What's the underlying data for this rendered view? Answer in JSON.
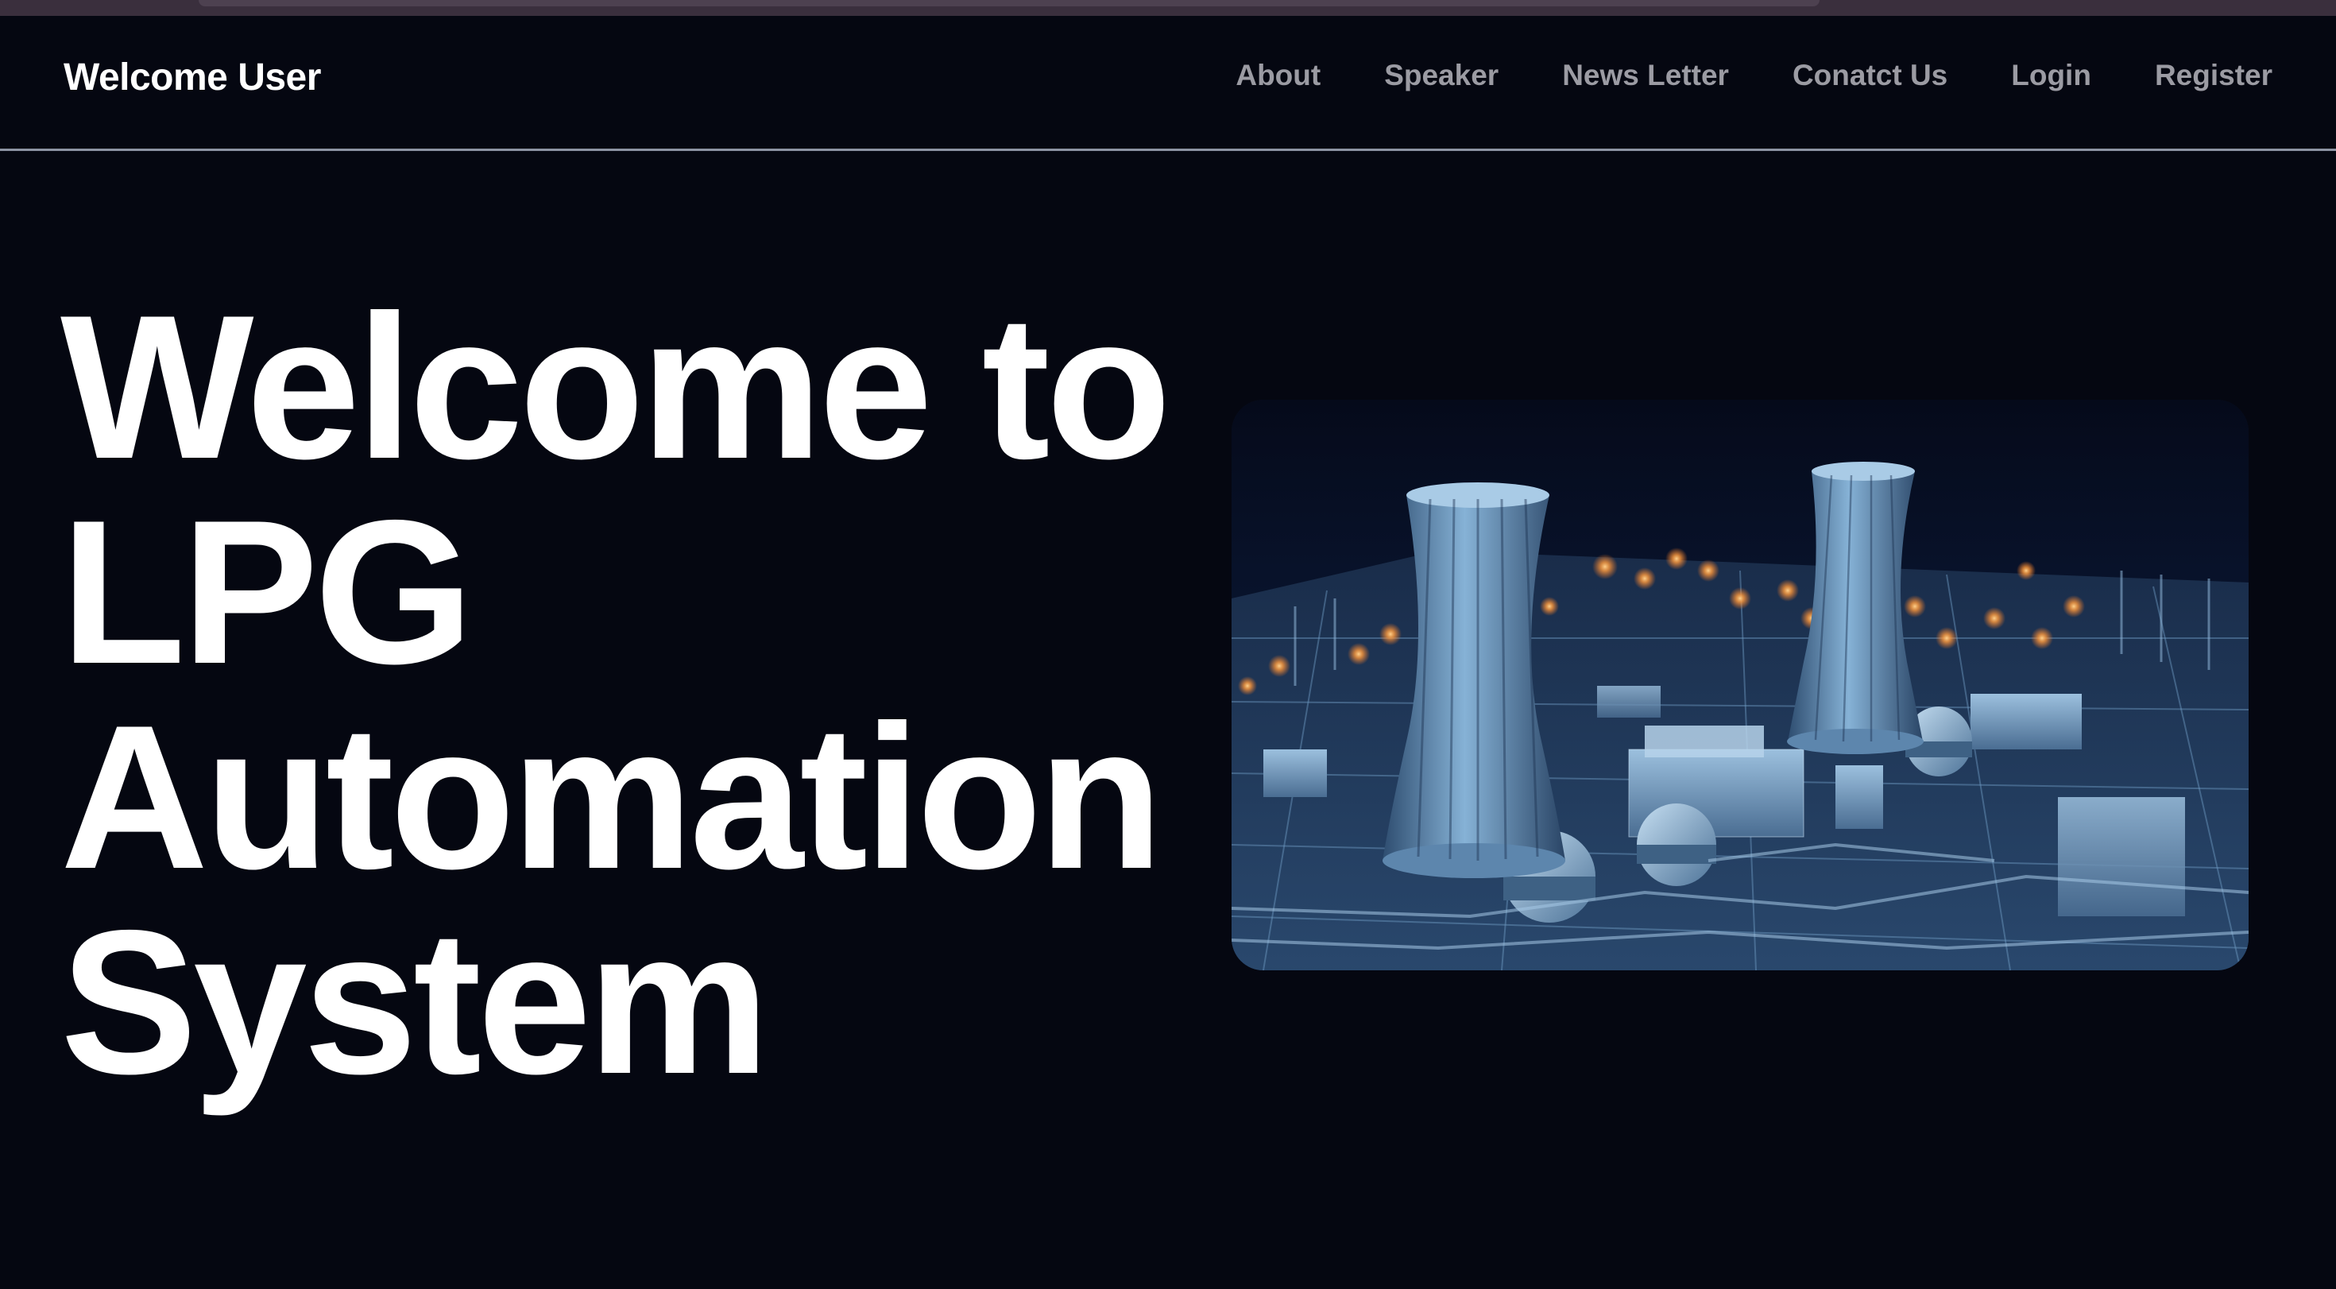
{
  "header": {
    "brand": "Welcome User",
    "nav": [
      {
        "label": "About"
      },
      {
        "label": "Speaker"
      },
      {
        "label": "News Letter"
      },
      {
        "label": "Conatct Us"
      },
      {
        "label": "Login"
      },
      {
        "label": "Register"
      }
    ]
  },
  "hero": {
    "title_lines": [
      "Welcome to",
      "LPG",
      "Automation",
      "System"
    ],
    "image": {
      "subject": "industrial-plant-cooling-towers"
    }
  },
  "colors": {
    "background": "#050711",
    "brand_text": "#ffffff",
    "nav_text": "#9b9ba3",
    "divider": "#8d93a3",
    "image_accent": "#7fb0d8"
  }
}
